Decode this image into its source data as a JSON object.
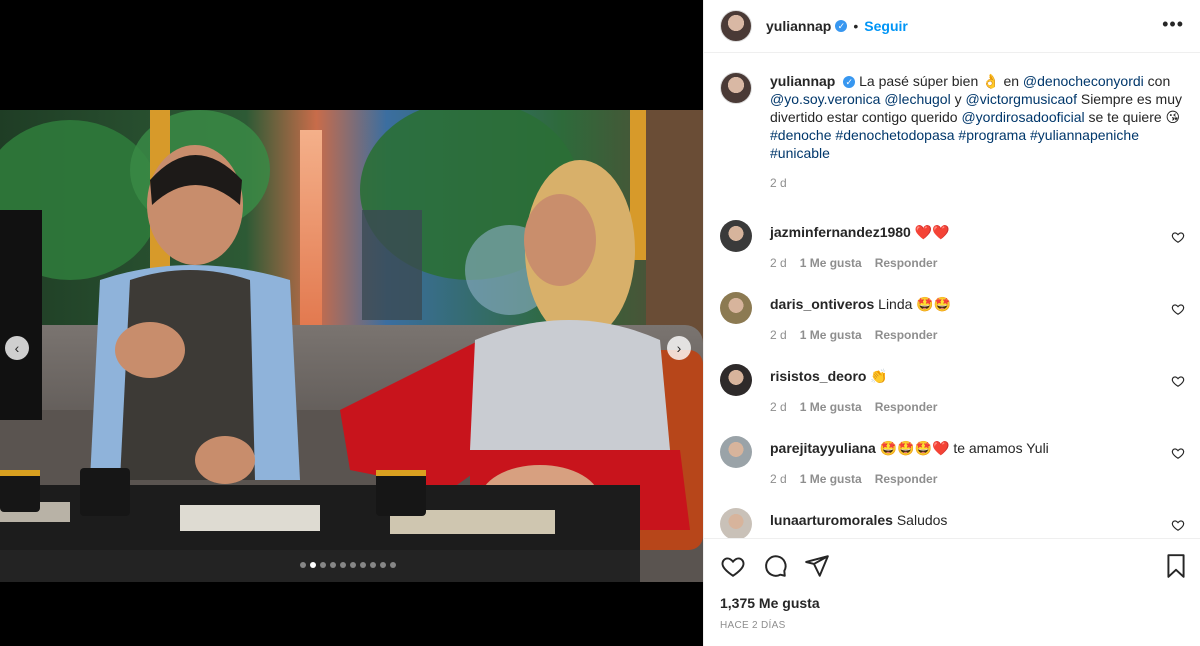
{
  "post": {
    "username": "yuliannap",
    "follow_label": "Seguir",
    "separator": "•",
    "more_label": "•••"
  },
  "caption": {
    "username": "yuliannap",
    "parts": [
      {
        "text": "La pasé súper bien 👌 en ",
        "link": false
      },
      {
        "text": "@denocheconyordi",
        "link": true
      },
      {
        "text": " con ",
        "link": false
      },
      {
        "text": "@yo.soy.veronica",
        "link": true
      },
      {
        "text": " ",
        "link": false
      },
      {
        "text": "@lechugol",
        "link": true
      },
      {
        "text": " y ",
        "link": false
      },
      {
        "text": "@victorgmusicaof",
        "link": true
      },
      {
        "text": " Siempre es muy divertido estar contigo querido ",
        "link": false
      },
      {
        "text": "@yordirosadooficial",
        "link": true
      },
      {
        "text": " se te quiere 😘 ",
        "link": false
      },
      {
        "text": "#denoche",
        "link": true
      },
      {
        "text": " ",
        "link": false
      },
      {
        "text": "#denochetodopasa",
        "link": true
      },
      {
        "text": " ",
        "link": false
      },
      {
        "text": "#programa",
        "link": true
      },
      {
        "text": " ",
        "link": false
      },
      {
        "text": "#yuliannapeniche",
        "link": true
      },
      {
        "text": " ",
        "link": false
      },
      {
        "text": "#unicable",
        "link": true
      }
    ],
    "time": "2 d"
  },
  "comments": [
    {
      "user": "jazminfernandez1980",
      "text": "❤️❤️",
      "time": "2 d",
      "likes": "1 Me gusta",
      "reply": "Responder",
      "avatar_color": "#3a3a3a"
    },
    {
      "user": "daris_ontiveros",
      "text": "Linda 🤩🤩",
      "time": "2 d",
      "likes": "1 Me gusta",
      "reply": "Responder",
      "avatar_color": "#8c7a52"
    },
    {
      "user": "risistos_deoro",
      "text": "👏",
      "time": "2 d",
      "likes": "1 Me gusta",
      "reply": "Responder",
      "avatar_color": "#2e2a2a"
    },
    {
      "user": "parejitayyuliana",
      "text": "🤩🤩🤩❤️ te amamos Yuli",
      "time": "2 d",
      "likes": "1 Me gusta",
      "reply": "Responder",
      "avatar_color": "#9aa3a8"
    },
    {
      "user": "lunaarturomorales",
      "text": "Saludos",
      "time": "",
      "likes": "",
      "reply": "",
      "avatar_color": "#c9c1b8"
    }
  ],
  "footer": {
    "likes": "1,375 Me gusta",
    "posted": "HACE 2 DÍAS"
  },
  "carousel": {
    "dots": 10,
    "active_dot": 1,
    "prev_label": "‹",
    "next_label": "›"
  },
  "colors": {
    "link": "#00376b",
    "follow": "#0095f6",
    "verified": "#3897f0",
    "muted": "#8e8e8e"
  }
}
